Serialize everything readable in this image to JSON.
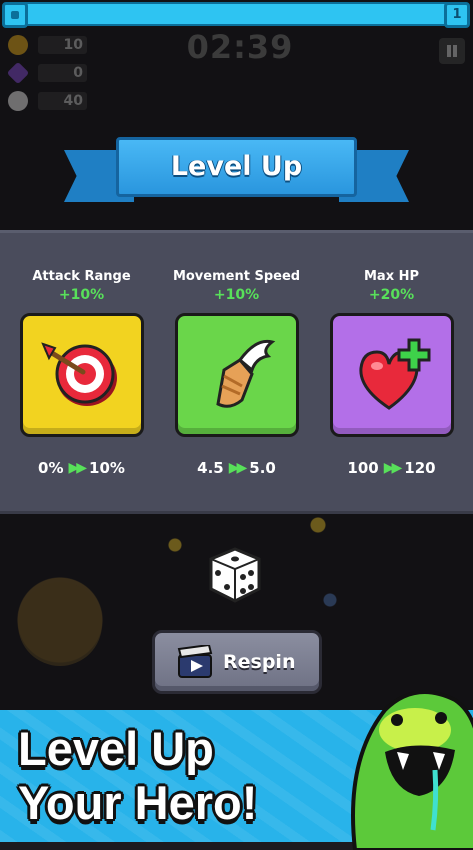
{
  "hud": {
    "level": "1",
    "timer": "02:39",
    "coins": "10",
    "gems": "0",
    "kills": "40"
  },
  "level_up": {
    "title": "Level Up",
    "cards": [
      {
        "name": "Attack Range",
        "bonus": "+10%",
        "from": "0%",
        "to": "10%",
        "color": "#f2d320",
        "icon": "target-arrow-icon"
      },
      {
        "name": "Movement Speed",
        "bonus": "+10%",
        "from": "4.5",
        "to": "5.0",
        "color": "#6ad64a",
        "icon": "winged-boot-icon"
      },
      {
        "name": "Max HP",
        "bonus": "+20%",
        "from": "100",
        "to": "120",
        "color": "#b36fe8",
        "icon": "heart-plus-icon"
      }
    ],
    "respin_label": "Respin"
  },
  "promo": {
    "line1": "Level Up",
    "line2": "Your Hero!"
  },
  "colors": {
    "accent_green": "#58e05a",
    "banner_blue": "#2a96de",
    "panel": "#4a4c5c"
  }
}
